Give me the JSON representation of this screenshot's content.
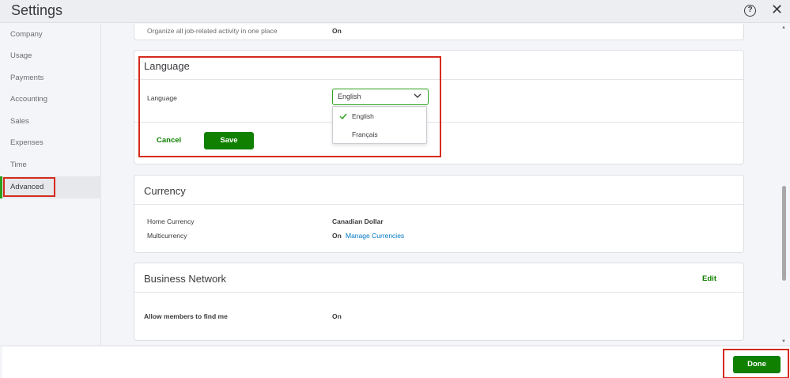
{
  "header": {
    "title": "Settings",
    "help_glyph": "?",
    "close_glyph": "✕"
  },
  "sidebar": {
    "items": [
      {
        "label": "Company"
      },
      {
        "label": "Usage"
      },
      {
        "label": "Payments"
      },
      {
        "label": "Accounting"
      },
      {
        "label": "Sales"
      },
      {
        "label": "Expenses"
      },
      {
        "label": "Time"
      },
      {
        "label": "Advanced",
        "active": true
      }
    ]
  },
  "top_card": {
    "text": "Organize all job-related activity in one place",
    "value": "On"
  },
  "language": {
    "title": "Language",
    "field_label": "Language",
    "selected": "English",
    "options": [
      "English",
      "Français"
    ],
    "cancel_label": "Cancel",
    "save_label": "Save"
  },
  "currency": {
    "title": "Currency",
    "home_label": "Home Currency",
    "home_value": "Canadian Dollar",
    "multi_label": "Multicurrency",
    "multi_value": "On",
    "manage_link": "Manage Currencies"
  },
  "business_network": {
    "title": "Business Network",
    "edit_label": "Edit",
    "allow_label": "Allow members to find me",
    "allow_value": "On"
  },
  "footer": {
    "done_label": "Done"
  },
  "colors": {
    "accent": "#108000",
    "highlight": "#d52b1e",
    "link": "#0077c5"
  }
}
